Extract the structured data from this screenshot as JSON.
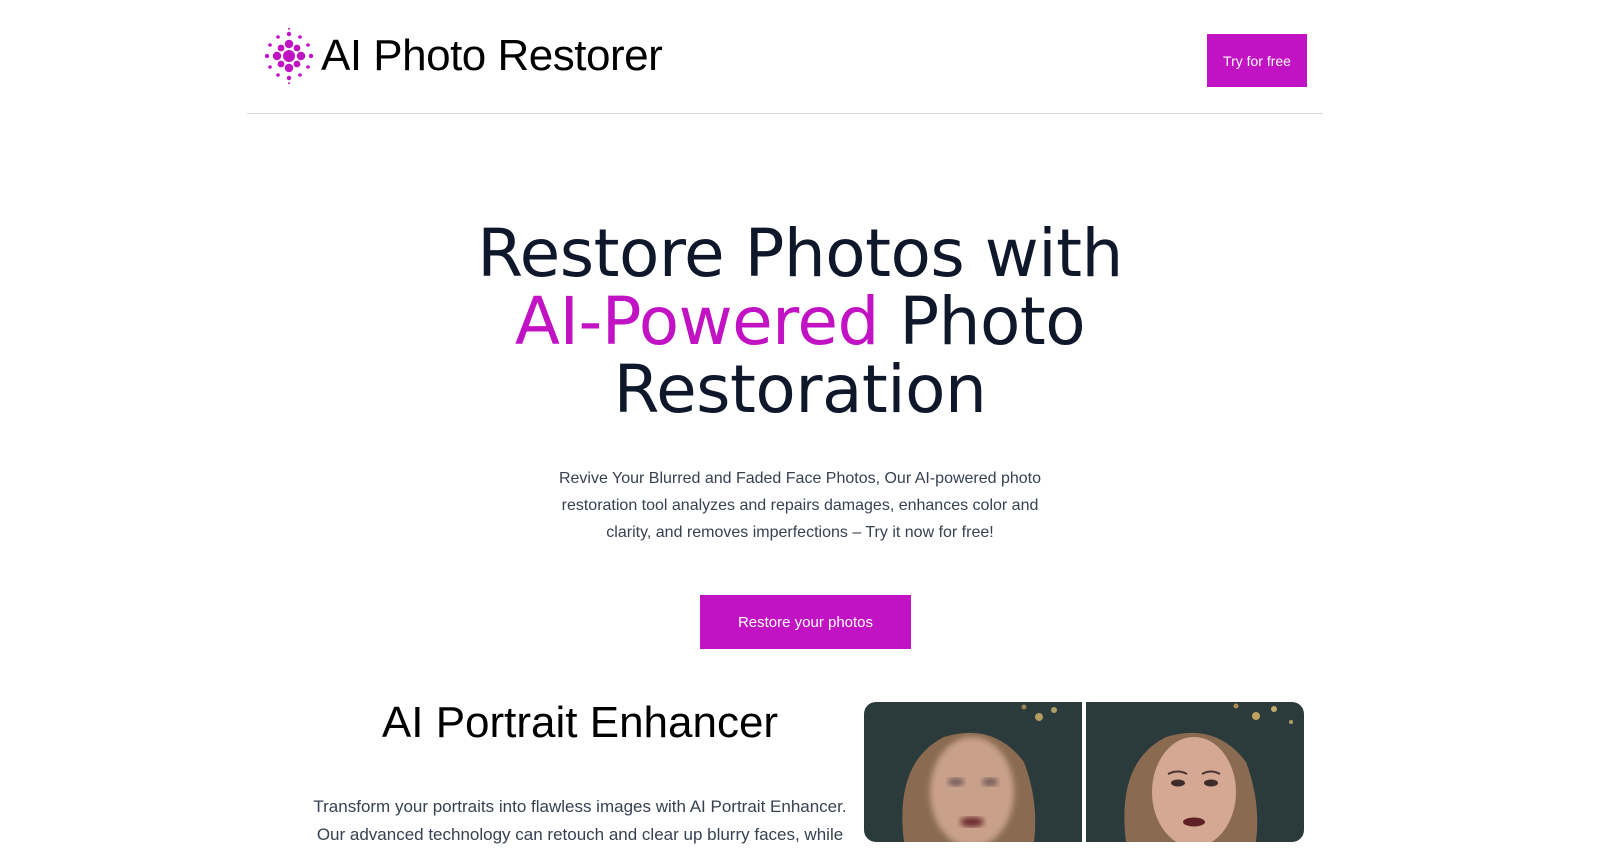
{
  "header": {
    "brand_name": "AI Photo Restorer",
    "cta_label": "Try for free"
  },
  "hero": {
    "title_part1": "Restore Photos with",
    "title_accent": "AI-Powered",
    "title_part2": "Photo Restoration",
    "subtitle": "Revive Your Blurred and Faded Face Photos, Our AI-powered photo restoration tool analyzes and repairs damages, enhances color and clarity, and removes imperfections – Try it now for free!",
    "cta_label": "Restore your photos"
  },
  "section": {
    "title": "AI Portrait Enhancer",
    "description": "Transform your portraits into flawless images with AI Portrait Enhancer. Our advanced technology can retouch and clear up blurry faces, while"
  },
  "icons": {
    "logo": "dots-radial-logo-icon"
  },
  "colors": {
    "accent": "#c112c4",
    "text": "#0f172a",
    "body_text": "#374151"
  }
}
